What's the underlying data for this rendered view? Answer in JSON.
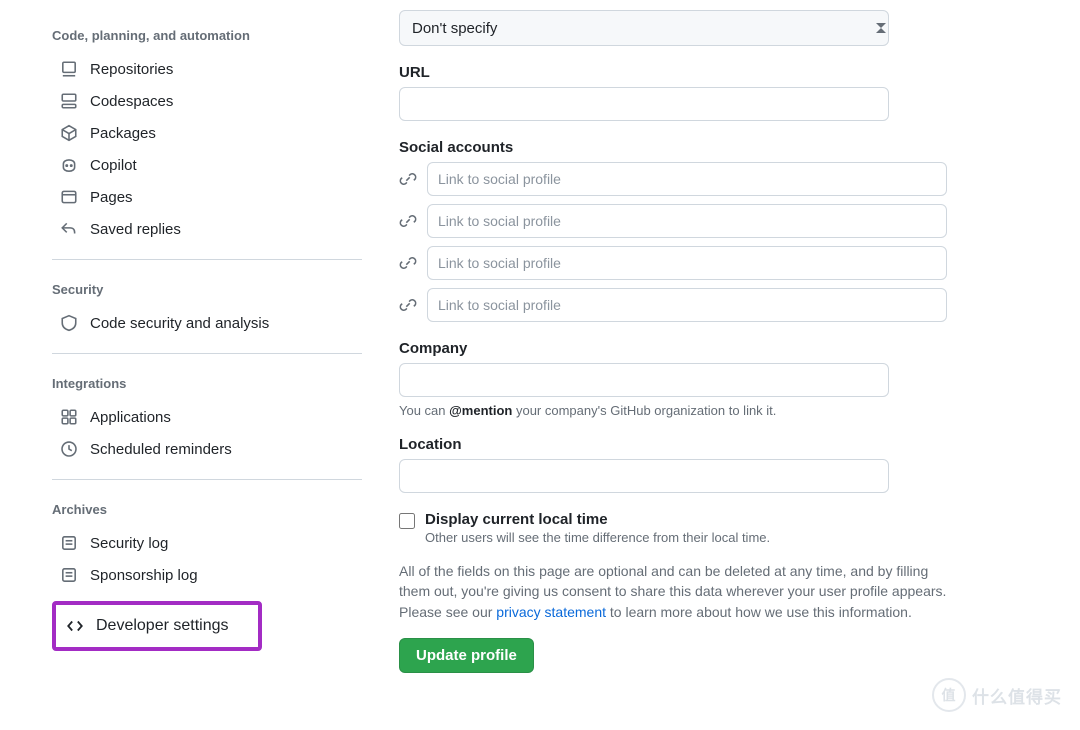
{
  "sidebar": {
    "group_code": {
      "title": "Code, planning, and automation",
      "items": [
        {
          "icon": "repo-icon",
          "label": "Repositories"
        },
        {
          "icon": "codespaces-icon",
          "label": "Codespaces"
        },
        {
          "icon": "package-icon",
          "label": "Packages"
        },
        {
          "icon": "copilot-icon",
          "label": "Copilot"
        },
        {
          "icon": "browser-icon",
          "label": "Pages"
        },
        {
          "icon": "reply-icon",
          "label": "Saved replies"
        }
      ]
    },
    "group_security": {
      "title": "Security",
      "items": [
        {
          "icon": "shield-icon",
          "label": "Code security and analysis"
        }
      ]
    },
    "group_integrations": {
      "title": "Integrations",
      "items": [
        {
          "icon": "apps-icon",
          "label": "Applications"
        },
        {
          "icon": "clock-icon",
          "label": "Scheduled reminders"
        }
      ]
    },
    "group_archives": {
      "title": "Archives",
      "items": [
        {
          "icon": "log-icon",
          "label": "Security log"
        },
        {
          "icon": "log-icon",
          "label": "Sponsorship log"
        }
      ]
    },
    "developer_settings": {
      "icon": "code-icon",
      "label": "Developer settings"
    }
  },
  "form": {
    "pronouns_value": "Don't specify",
    "url_label": "URL",
    "url_value": "",
    "social_label": "Social accounts",
    "social_placeholder": "Link to social profile",
    "company_label": "Company",
    "company_value": "",
    "company_help_prefix": "You can ",
    "company_help_bold": "@mention",
    "company_help_suffix": " your company's GitHub organization to link it.",
    "location_label": "Location",
    "location_value": "",
    "display_time_label": "Display current local time",
    "display_time_sub": "Other users will see the time difference from their local time.",
    "consent_text_1": "All of the fields on this page are optional and can be deleted at any time, and by filling them out, you're giving us consent to share this data wherever your user profile appears. Please see our ",
    "consent_link": "privacy statement",
    "consent_text_2": " to learn more about how we use this information.",
    "submit_label": "Update profile"
  },
  "watermark": {
    "circle": "值",
    "text": "什么值得买"
  }
}
